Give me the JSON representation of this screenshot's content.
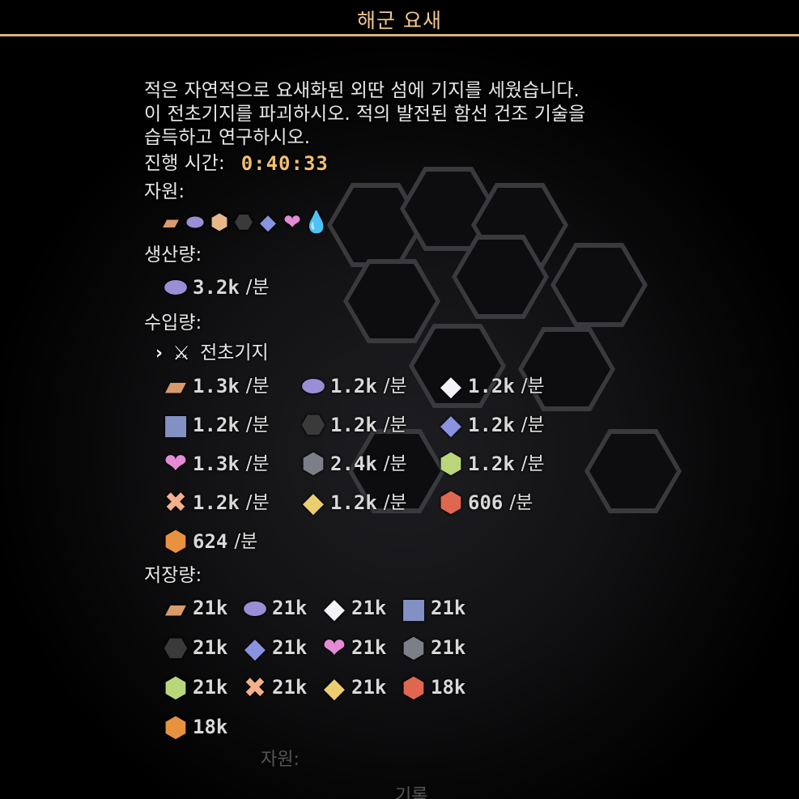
{
  "window": {
    "title": "해군 요새"
  },
  "mission": {
    "description": "적은 자연적으로 요새화된 외딴 섬에 기지를 세웠습니다.\n이 전초기지를 파괴하시오. 적의 발전된 함선 건조 기술을\n습득하고 연구하시오.",
    "elapsed_label": "진행 시간:",
    "elapsed_value": "0:40:33"
  },
  "resources": {
    "label": "자원:",
    "icons": [
      "copper-icon",
      "lead-icon",
      "sand-icon",
      "coal-icon",
      "titanium-icon",
      "spore-pod-icon",
      "water-icon"
    ]
  },
  "production": {
    "label": "생산량:",
    "items": [
      {
        "icon": "lead-icon",
        "value": "3.2k",
        "unit": "/분"
      }
    ]
  },
  "imports": {
    "label": "수입량:",
    "source_label": "전초기지",
    "items": [
      {
        "icon": "copper-icon",
        "value": "1.3k",
        "unit": "/분"
      },
      {
        "icon": "lead-icon",
        "value": "1.2k",
        "unit": "/분"
      },
      {
        "icon": "metaglass-icon",
        "value": "1.2k",
        "unit": "/분"
      },
      {
        "icon": "graphite-icon",
        "value": "1.2k",
        "unit": "/분"
      },
      {
        "icon": "coal-icon",
        "value": "1.2k",
        "unit": "/분"
      },
      {
        "icon": "titanium-icon",
        "value": "1.2k",
        "unit": "/분"
      },
      {
        "icon": "spore-pod-icon",
        "value": "1.3k",
        "unit": "/분"
      },
      {
        "icon": "scrap-icon",
        "value": "2.4k",
        "unit": "/분"
      },
      {
        "icon": "plastanium-icon",
        "value": "1.2k",
        "unit": "/분"
      },
      {
        "icon": "pyratite-icon",
        "value": "1.2k",
        "unit": "/분"
      },
      {
        "icon": "surge-alloy-icon",
        "value": "1.2k",
        "unit": "/분"
      },
      {
        "icon": "blast-compound-icon",
        "value": "606",
        "unit": "/분"
      },
      {
        "icon": "phase-fabric-icon",
        "value": "624",
        "unit": "/분"
      }
    ]
  },
  "storage": {
    "label": "저장량:",
    "items": [
      {
        "icon": "copper-icon",
        "value": "21k"
      },
      {
        "icon": "lead-icon",
        "value": "21k"
      },
      {
        "icon": "metaglass-icon",
        "value": "21k"
      },
      {
        "icon": "graphite-icon",
        "value": "21k"
      },
      {
        "icon": "coal-icon",
        "value": "21k"
      },
      {
        "icon": "titanium-icon",
        "value": "21k"
      },
      {
        "icon": "spore-pod-icon",
        "value": "21k"
      },
      {
        "icon": "scrap-icon",
        "value": "21k"
      },
      {
        "icon": "plastanium-icon",
        "value": "21k"
      },
      {
        "icon": "pyratite-icon",
        "value": "21k"
      },
      {
        "icon": "surge-alloy-icon",
        "value": "21k"
      },
      {
        "icon": "blast-compound-icon",
        "value": "18k"
      },
      {
        "icon": "phase-fabric-icon",
        "value": "18k"
      }
    ]
  },
  "background": {
    "resources_label": "자원:",
    "record_label": "기록"
  },
  "colors": {
    "accent": "#d8b47a",
    "title_text": "#f2c98e",
    "timer": "#f0c070"
  }
}
